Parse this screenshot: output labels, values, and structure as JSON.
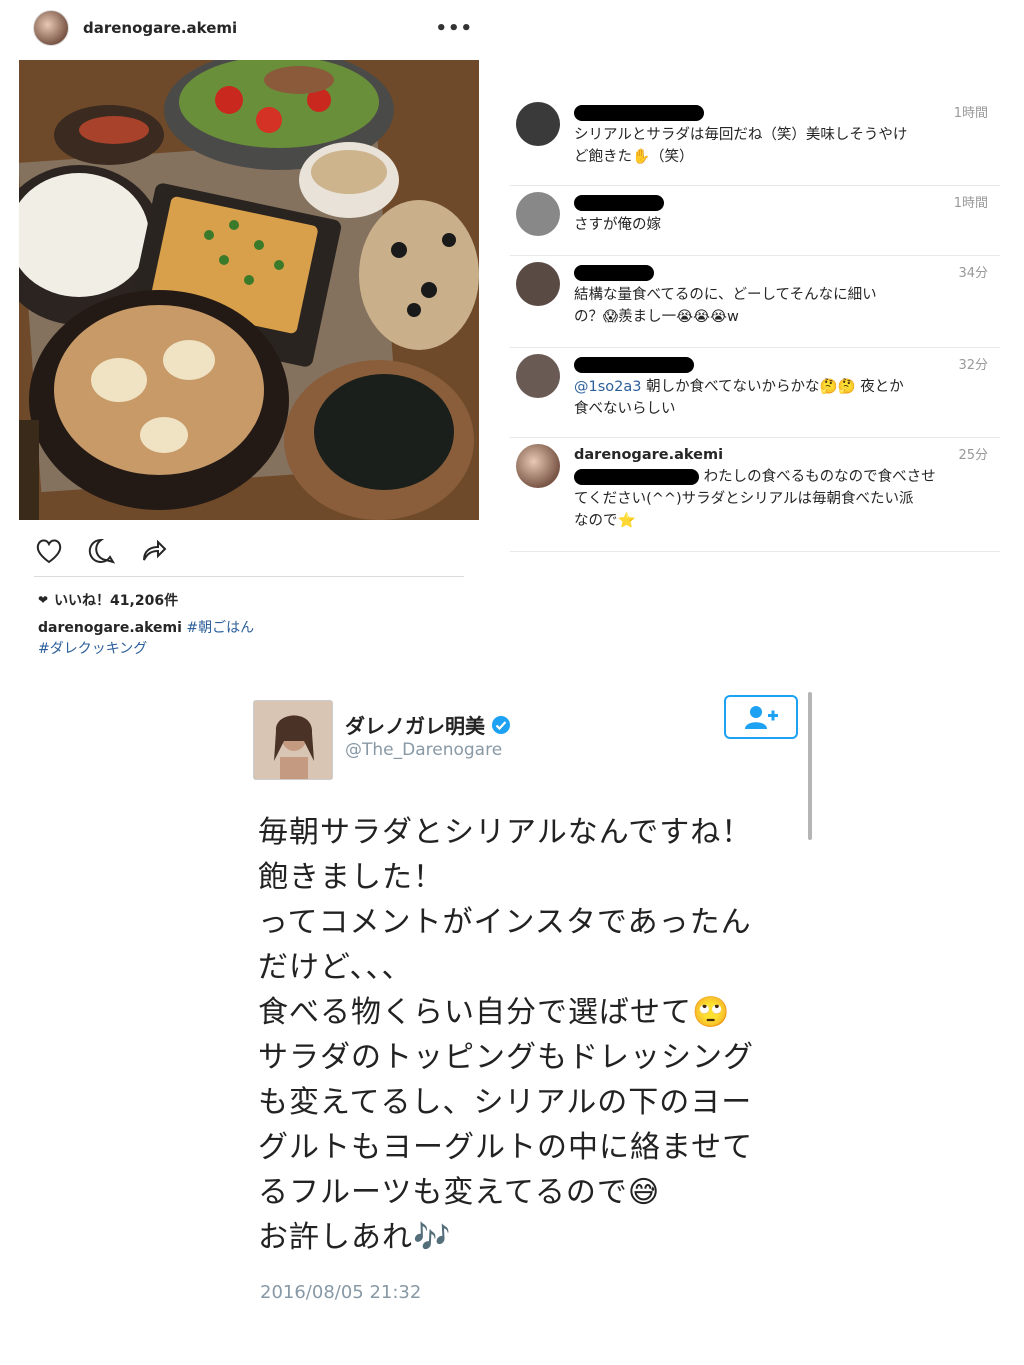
{
  "instagram": {
    "username": "darenogare.akemi",
    "more": "•••",
    "likes_label": "いいね！41,206件",
    "caption": {
      "user": "darenogare.akemi",
      "tag1": "#朝ごはん",
      "tag2": "#ダレクッキング"
    }
  },
  "comments": [
    {
      "user": "",
      "time": "1時間",
      "line1": "シリアルとサラダは毎回だね（笑）美味しそうやけ",
      "line2": "ど飽きた✋（笑）"
    },
    {
      "user": "",
      "time": "1時間",
      "line1": "さすが俺の嫁",
      "line2": ""
    },
    {
      "user": "",
      "time": "34分",
      "line1": "結構な量食べてるのに、どーしてそんなに細い",
      "line2": "の？😱羨まし一😭😭😭w"
    },
    {
      "user": "",
      "time": "32分",
      "mention": "@1so2a3",
      "line1": " 朝しか食べてないからかな🤔🤔 夜とか",
      "line2": "食べないらしい"
    },
    {
      "user": "darenogare.akemi",
      "time": "25分",
      "line1": "わたしの食べるものなので食べさせ",
      "line2": "てください(^^)サラダとシリアルは毎朝食べたい派",
      "line3": "なので⭐"
    }
  ],
  "twitter": {
    "name": "ダレノガレ明美",
    "handle": "@The_Darenogare",
    "lines": [
      "毎朝サラダとシリアルなんですね！",
      "飽きました！",
      "ってコメントがインスタであったん",
      "だけど、、、",
      "食べる物くらい自分で選ばせて🙄",
      "サラダのトッピングもドレッシング",
      "も変えてるし、シリアルの下のヨー",
      "グルトもヨーグルトの中に絡ませて",
      "るフルーツも変えてるので😅",
      "お許しあれ🎶"
    ],
    "date": "2016/08/05 21:32"
  },
  "colors": {
    "link": "#2d5f9a",
    "twitter_blue": "#1da1f2",
    "muted": "#8899a6"
  }
}
